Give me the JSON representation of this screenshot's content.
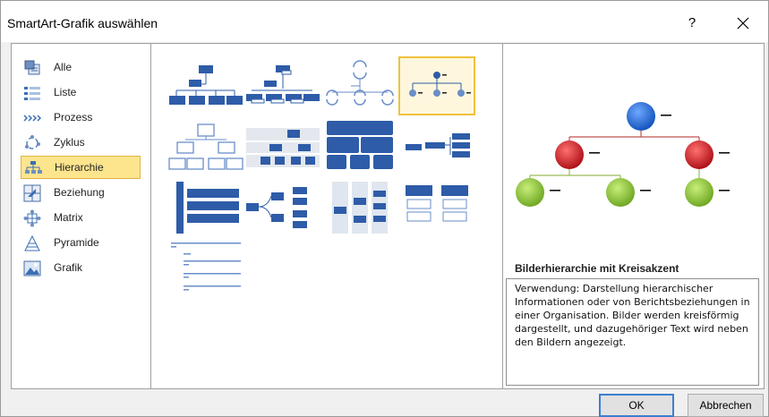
{
  "window": {
    "title": "SmartArt-Grafik auswählen",
    "help_label": "?"
  },
  "categories": [
    {
      "label": "Alle",
      "icon": "all-icon"
    },
    {
      "label": "Liste",
      "icon": "list-icon"
    },
    {
      "label": "Prozess",
      "icon": "process-icon"
    },
    {
      "label": "Zyklus",
      "icon": "cycle-icon"
    },
    {
      "label": "Hierarchie",
      "icon": "hierarchy-icon",
      "selected": true
    },
    {
      "label": "Beziehung",
      "icon": "relationship-icon"
    },
    {
      "label": "Matrix",
      "icon": "matrix-icon"
    },
    {
      "label": "Pyramide",
      "icon": "pyramid-icon"
    },
    {
      "label": "Grafik",
      "icon": "picture-icon"
    }
  ],
  "gallery": {
    "selected_index": 3,
    "tile_count": 13
  },
  "preview": {
    "title": "Bilderhierarchie mit Kreisakzent",
    "description": "Verwendung: Darstellung hierarchischer Informationen oder von Berichtsbeziehungen in einer Organisation. Bilder werden kreisförmig dargestellt, und dazugehöriger Text wird neben den Bildern angezeigt."
  },
  "buttons": {
    "ok": "OK",
    "cancel": "Abbrechen"
  },
  "colors": {
    "selection_fill": "#fde58e",
    "selection_border": "#e3b341",
    "accent_blue": "#3c6fb4",
    "node_blue": "#1f63c6",
    "node_red": "#c0141a",
    "node_green": "#7cb52a",
    "connector_red": "#c0504d",
    "connector_green": "#9bbb59"
  }
}
